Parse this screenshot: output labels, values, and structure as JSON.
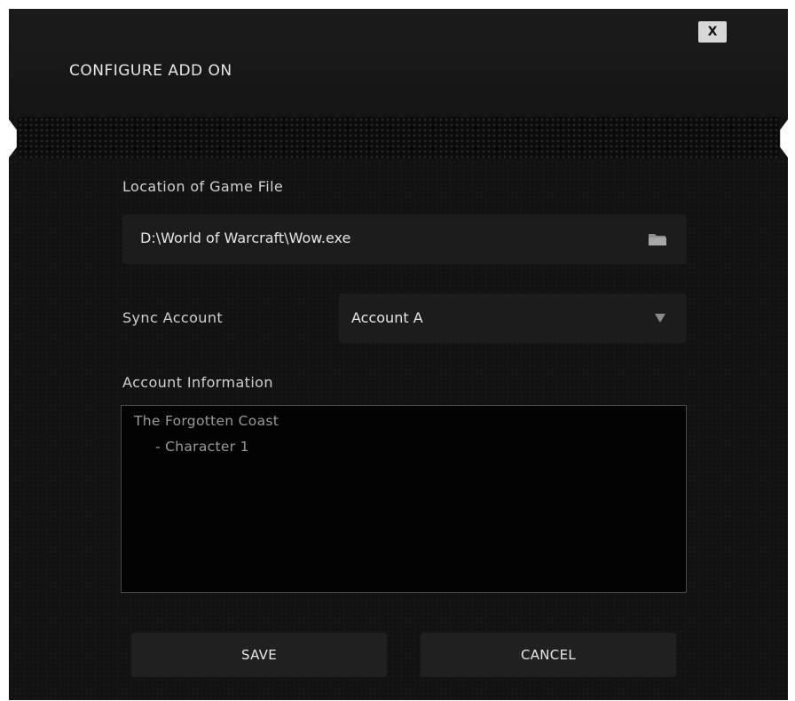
{
  "dialog": {
    "title": "CONFIGURE ADD ON",
    "close_label": "X"
  },
  "game_file": {
    "label": "Location of Game File",
    "value": "D:\\World of Warcraft\\Wow.exe",
    "browse_icon": "folder-icon"
  },
  "sync_account": {
    "label": "Sync Account",
    "selected": "Account A",
    "dropdown_icon": "chevron-down-icon"
  },
  "account_info": {
    "label": "Account Information",
    "lines": [
      "The Forgotten Coast",
      "- Character 1"
    ]
  },
  "buttons": {
    "save": "SAVE",
    "cancel": "CANCEL"
  },
  "colors": {
    "background": "#121212",
    "field": "#1c1c1c",
    "text": "#e6e6e6",
    "muted_text": "#9a9a9a"
  }
}
